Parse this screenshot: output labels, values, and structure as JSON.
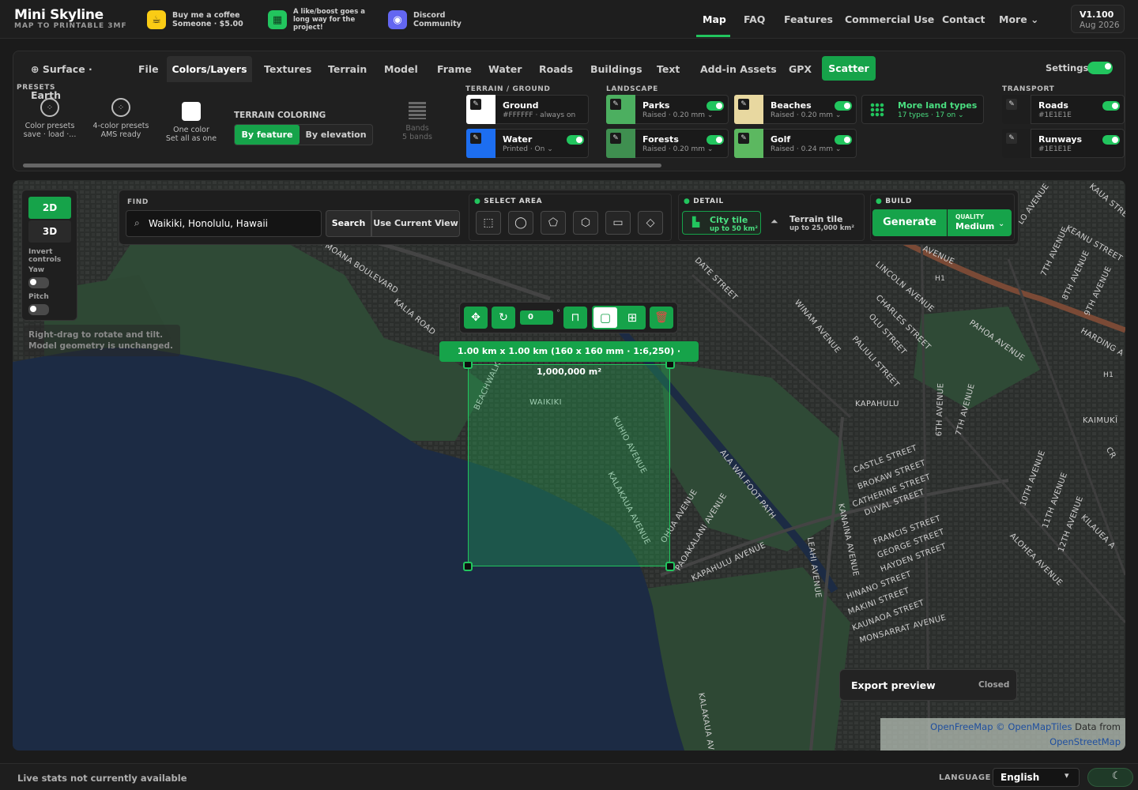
{
  "brand": {
    "name": "Mini Skyline",
    "tagline": "MAP TO PRINTABLE 3MF"
  },
  "promos": [
    {
      "icon": "coffee-icon",
      "line1": "Buy me a coffee",
      "line2": "Someone · $5.00",
      "color": "#facc15"
    },
    {
      "icon": "boost-icon",
      "line1": "A like/boost goes a",
      "line2": "long way for the",
      "line3": "project!",
      "color": "#22c55e"
    },
    {
      "icon": "discord-icon",
      "line1": "Discord",
      "line2": "Community",
      "color": "#6366f1"
    }
  ],
  "nav": [
    "Map",
    "FAQ",
    "Features",
    "Commercial Use",
    "Contact",
    "More"
  ],
  "version": {
    "number": "V1.100",
    "date": "Aug 2026"
  },
  "tabs": [
    "Surface · Earth",
    "File",
    "Colors/Layers",
    "Textures",
    "Terrain",
    "Model",
    "Frame",
    "Water",
    "Roads",
    "Buildings",
    "Text",
    "Add-in Assets",
    "GPX",
    "Scatter"
  ],
  "settings_label": "Settings",
  "presets": {
    "title": "PRESETS",
    "items": [
      {
        "l1": "Color presets",
        "l2": "save · load ·..."
      },
      {
        "l1": "4-color presets",
        "l2": "AMS ready"
      },
      {
        "l1": "One color",
        "l2": "Set all as one"
      }
    ]
  },
  "terrain_coloring": {
    "title": "TERRAIN COLORING",
    "by_feature": "By feature",
    "by_elevation": "By elevation",
    "bands": "Bands",
    "bands_sub": "5 bands"
  },
  "terrain_ground": {
    "title": "TERRAIN / GROUND",
    "ground": {
      "name": "Ground",
      "sub": "#FFFFFF · always on",
      "color": "#FFFFFF"
    },
    "water": {
      "name": "Water",
      "sub": "Printed · On",
      "color": "#1d6ef0"
    }
  },
  "landscape": {
    "title": "LANDSCAPE",
    "parks": {
      "name": "Parks",
      "sub": "Raised · 0.20 mm",
      "color": "#4caf60"
    },
    "beaches": {
      "name": "Beaches",
      "sub": "Raised · 0.20 mm",
      "color": "#e8d8a0"
    },
    "forests": {
      "name": "Forests",
      "sub": "Raised · 0.20 mm",
      "color": "#3f8f50"
    },
    "golf": {
      "name": "Golf",
      "sub": "Raised · 0.24 mm",
      "color": "#5cb860"
    },
    "more": {
      "name": "More land types",
      "sub": "17 types · 17 on"
    }
  },
  "transport": {
    "title": "TRANSPORT",
    "roads": {
      "name": "Roads",
      "sub": "#1E1E1E",
      "color": "#1E1E1E"
    },
    "runways": {
      "name": "Runways",
      "sub": "#1E1E1E",
      "color": "#1E1E1E"
    }
  },
  "view": {
    "mode_2d": "2D",
    "mode_3d": "3D",
    "invert": "Invert controls",
    "yaw": "Yaw",
    "pitch": "Pitch",
    "hint": "Right-drag to rotate and tilt. Model geometry is unchanged."
  },
  "find": {
    "title": "FIND",
    "query": "Waikiki, Honolulu, Hawaii",
    "search": "Search",
    "use_view": "Use Current View"
  },
  "select_area": {
    "title": "SELECT AREA"
  },
  "detail": {
    "title": "DETAIL",
    "city": "City tile",
    "city_sub": "up to 50 km²",
    "terrain": "Terrain tile",
    "terrain_sub": "up to 25,000 km²"
  },
  "build": {
    "title": "BUILD",
    "generate": "Generate",
    "quality_label": "QUALITY",
    "quality": "Medium"
  },
  "selection": {
    "rotation": "0",
    "dimensions": "1.00 km x 1.00 km (160 x 160 mm · 1:6,250) · 1,000,000 m²"
  },
  "export": {
    "label": "Export preview",
    "status": "Closed"
  },
  "attribution": {
    "line1a": "OpenFreeMap",
    "line1b": "© OpenMapTiles",
    "line1c": "Data from",
    "line2": "OpenStreetMap"
  },
  "map_labels": {
    "waikiki": "WAIKIKI",
    "kapahulu": "KAPAHULU",
    "kaimuki": "KAIMUKĪ",
    "streets": [
      "ALA MOANA BOULEVARD",
      "KALIA ROAD",
      "DATE STREET",
      "WINAM AVENUE",
      "LINCOLN AVENUE",
      "CHARLES STREET",
      "OLU STREET",
      "PALIULI STREET",
      "PAHOA AVENUE",
      "HARDING A",
      "KAUA STREET",
      "KEANU STREET",
      "LO AVENUE",
      "7TH AVENUE",
      "8TH AVENUE",
      "9TH AVENUE",
      "AVENUE",
      "ALA WAI FOOT PATH",
      "KUHIO AVENUE",
      "KALAKAUA AVENUE",
      "BEACHWALK",
      "OHUA AVENUE",
      "PAOAKALANI AVENUE",
      "KAPAHULU AVENUE",
      "LEAHI AVENUE",
      "KANAINA AVENUE",
      "CASTLE STREET",
      "BROKAW STREET",
      "CATHERINE STREET",
      "DUVAL STREET",
      "FRANCIS STREET",
      "GEORGE STREET",
      "HAYDEN STREET",
      "HINANO STREET",
      "MAKINI STREET",
      "KAUNAOA STREET",
      "MONSARRAT AVENUE",
      "6TH AVENUE",
      "7TH AVENUE",
      "10TH AVENUE",
      "11TH AVENUE",
      "12TH AVENUE",
      "ALOHEA AVENUE",
      "KILAUEA A",
      "KALAKAUA AV",
      "CR",
      "H1",
      "H1"
    ]
  },
  "footer": {
    "stats": "Live stats not currently available",
    "language_label": "LANGUAGE",
    "language": "English"
  }
}
